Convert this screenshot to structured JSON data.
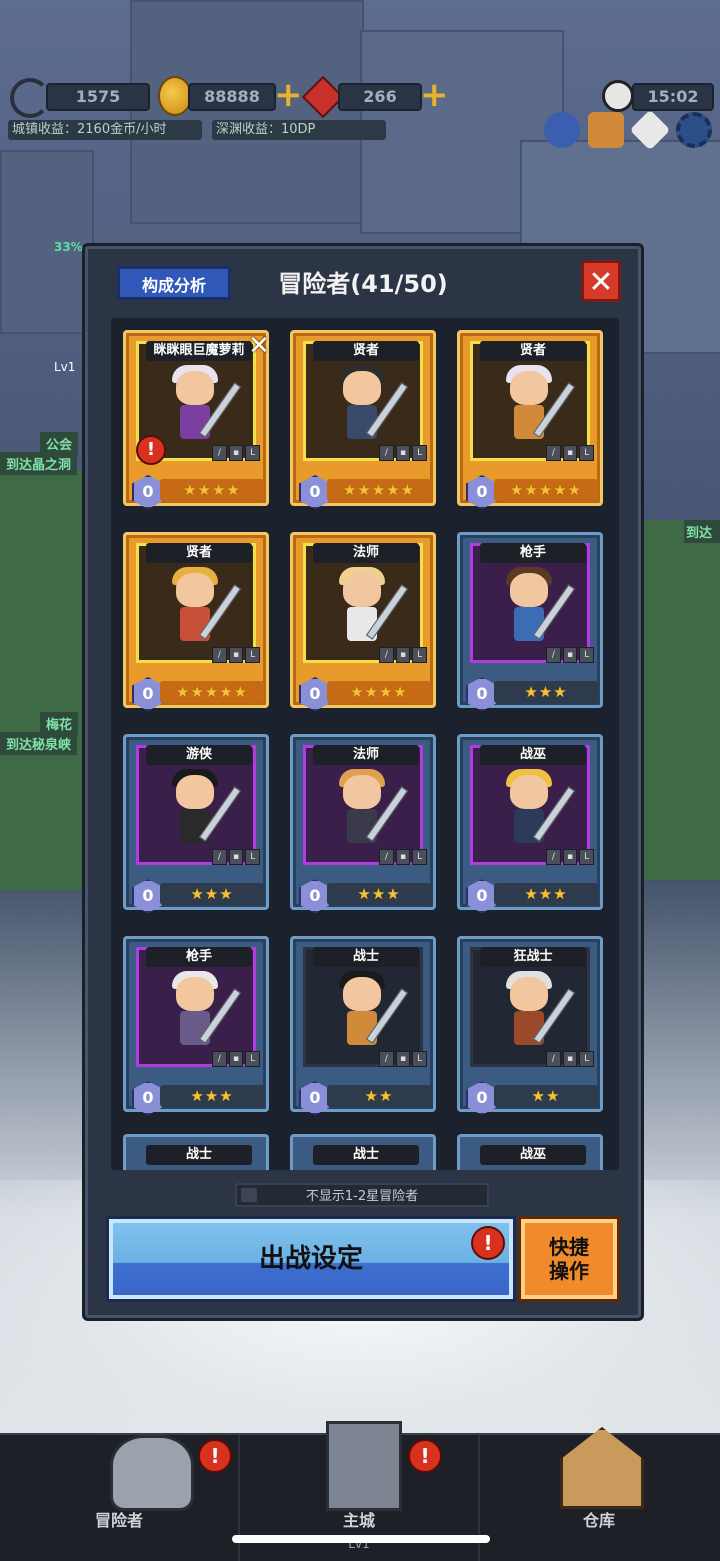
{
  "hud": {
    "swords": "1575",
    "gold": "88888",
    "gems": "266",
    "time": "15:02",
    "town_income": "城镇收益：2160金币/小时",
    "abyss_income": "深渊收益：10DP"
  },
  "background": {
    "progress_label": "33%",
    "level_label": "Lv1",
    "guild_label": "公会",
    "goto_crystal_cave": "到达晶之洞",
    "plum_label": "梅花",
    "goto_secret_spring": "到达秘泉峡",
    "goto_right": "到达"
  },
  "modal": {
    "analysis_button": "构成分析",
    "title": "冒险者(41/50)",
    "close_symbol": "✕",
    "filter_label": "不显示1-2星冒险者",
    "battle_setup_button": "出战设定",
    "quick_action_button": "快捷\n操作",
    "alert_symbol": "!"
  },
  "cards": [
    {
      "name": "眯眯眼巨魔萝莉",
      "stars": "★★★★",
      "rank": "0",
      "tier": "gold",
      "frame": "gold",
      "alert": true,
      "swap": true
    },
    {
      "name": "贤者",
      "stars": "★★★★★",
      "rank": "0",
      "tier": "gold",
      "frame": "gold"
    },
    {
      "name": "贤者",
      "stars": "★★★★★",
      "rank": "0",
      "tier": "gold",
      "frame": "gold"
    },
    {
      "name": "贤者",
      "stars": "★★★★★",
      "rank": "0",
      "tier": "gold",
      "frame": "gold"
    },
    {
      "name": "法师",
      "stars": "★★★★",
      "rank": "0",
      "tier": "gold",
      "frame": "gold"
    },
    {
      "name": "枪手",
      "stars": "★★★",
      "rank": "0",
      "tier": "blue",
      "frame": "purple"
    },
    {
      "name": "游侠",
      "stars": "★★★",
      "rank": "0",
      "tier": "blue",
      "frame": "purple"
    },
    {
      "name": "法师",
      "stars": "★★★",
      "rank": "0",
      "tier": "blue",
      "frame": "purple"
    },
    {
      "name": "战巫",
      "stars": "★★★",
      "rank": "0",
      "tier": "blue",
      "frame": "purple"
    },
    {
      "name": "枪手",
      "stars": "★★★",
      "rank": "0",
      "tier": "blue",
      "frame": "purple"
    },
    {
      "name": "战士",
      "stars": "★★",
      "rank": "0",
      "tier": "blue",
      "frame": "plain"
    },
    {
      "name": "狂战士",
      "stars": "★★",
      "rank": "0",
      "tier": "blue",
      "frame": "plain"
    }
  ],
  "partial_cards": [
    "战士",
    "战士",
    "战巫"
  ],
  "nav": {
    "adventurers": "冒险者",
    "main_city": "主城",
    "main_city_level": "Lv1",
    "warehouse": "仓库"
  },
  "icons": {
    "hud_left": "sword-icon",
    "hud_gold": "coin-icon",
    "hud_gem": "gem-icon",
    "hud_time": "clock-icon",
    "top_right": [
      "party-icon",
      "cat-icon",
      "compass-icon",
      "gear-icon"
    ]
  }
}
